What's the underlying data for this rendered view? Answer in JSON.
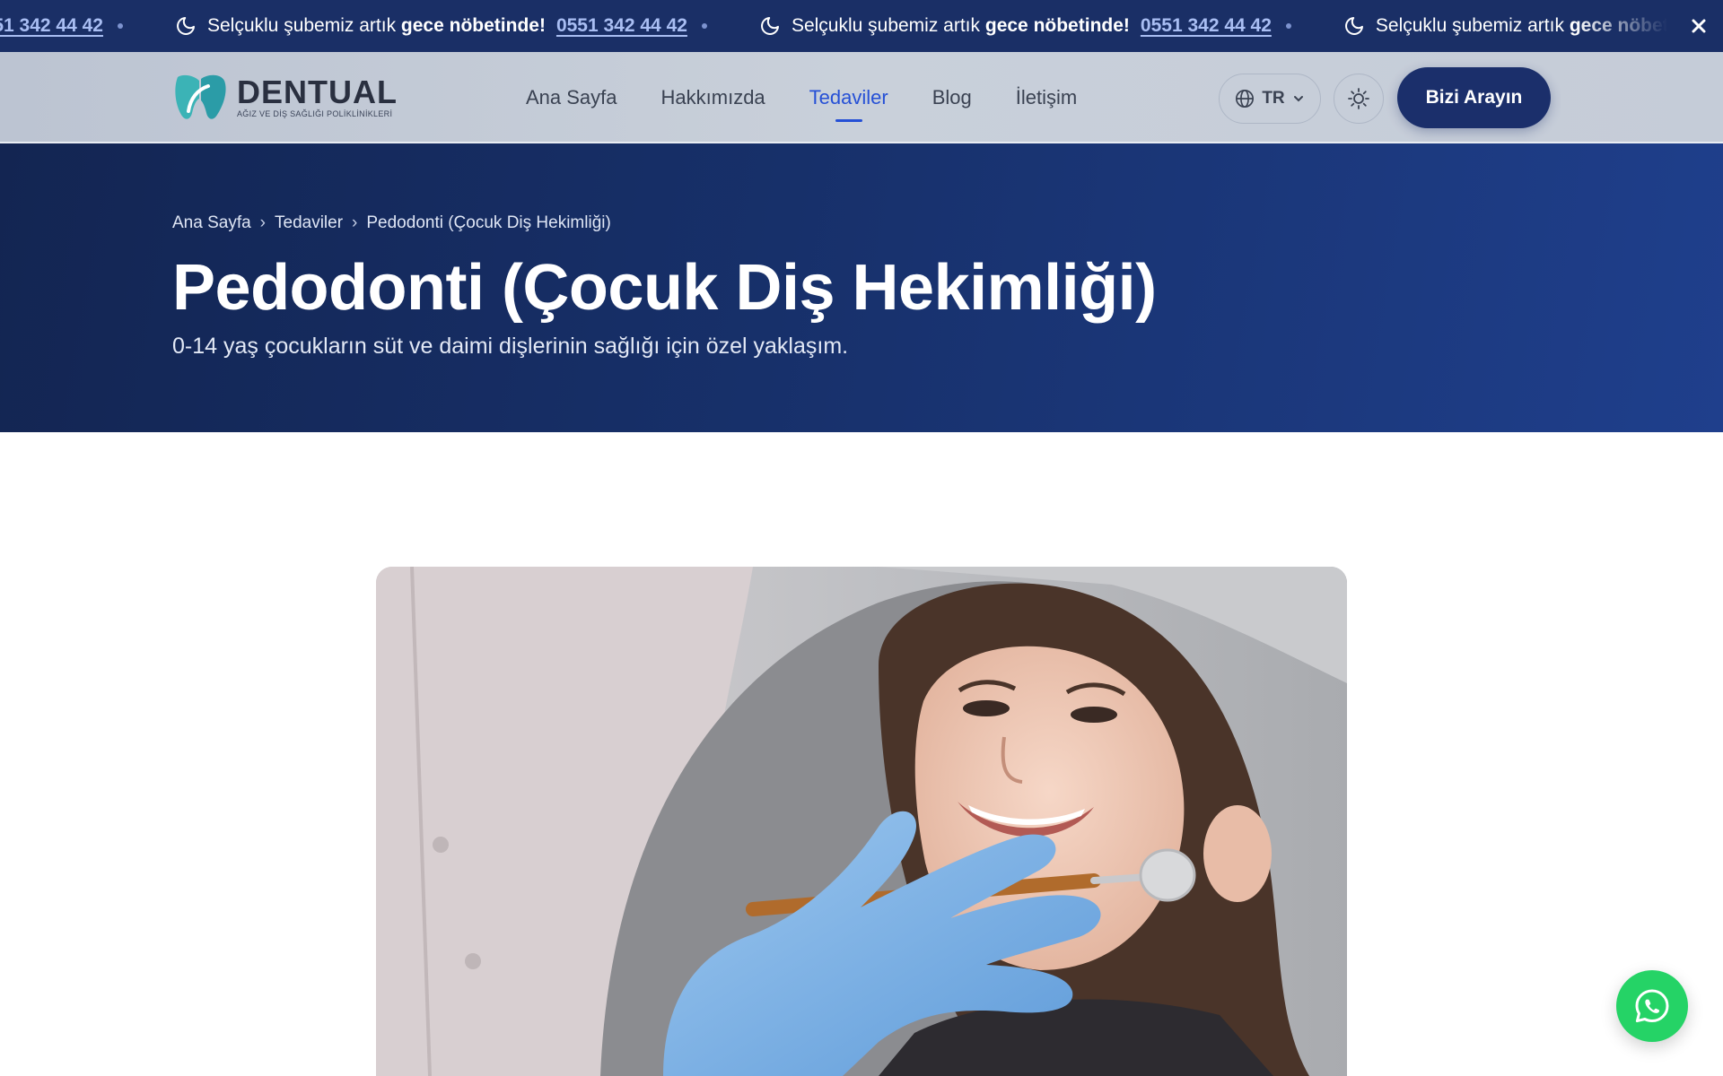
{
  "announcement": {
    "text_prefix": "Selçuklu şubemiz artık",
    "text_bold": "gece nöbetinde!",
    "phone": "0551 342 44 42",
    "icon": "moon-icon",
    "close_icon": "close-icon"
  },
  "header": {
    "logo_name": "DENTUAL",
    "logo_sub": "AĞIZ VE DİŞ SAĞLIĞI POLİKLİNİKLERİ",
    "nav": [
      {
        "label": "Ana Sayfa",
        "active": false
      },
      {
        "label": "Hakkımızda",
        "active": false
      },
      {
        "label": "Tedaviler",
        "active": true
      },
      {
        "label": "Blog",
        "active": false
      },
      {
        "label": "İletişim",
        "active": false
      }
    ],
    "language": "TR",
    "call_button": "Bizi Arayın"
  },
  "hero": {
    "breadcrumb": [
      "Ana Sayfa",
      "Tedaviler",
      "Pedodonti (Çocuk Diş Hekimliği)"
    ],
    "title": "Pedodonti (Çocuk Diş Hekimliği)",
    "subtitle": "0-14 yaş çocukların süt ve daimi dişlerinin sağlığı için özel yaklaşım."
  },
  "colors": {
    "announcement_bg": "#1a2f66",
    "hero_bg": "#17306a",
    "accent": "#2550d6",
    "button_bg": "#1b2f6b",
    "whatsapp": "#25d366"
  }
}
